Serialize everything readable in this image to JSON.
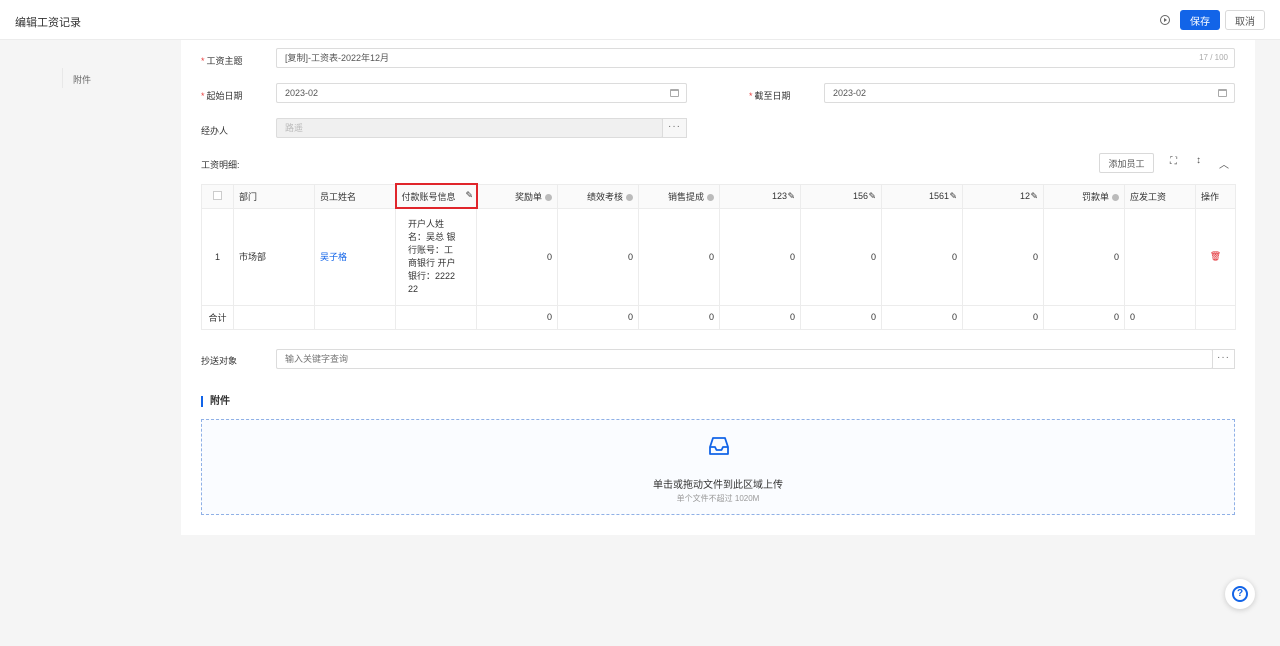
{
  "header": {
    "title": "编辑工资记录",
    "save_label": "保存",
    "cancel_label": "取消"
  },
  "sidebar": {
    "items": [
      {
        "label": "附件"
      }
    ]
  },
  "form": {
    "subject": {
      "label": "工资主题",
      "value": "[复制]-工资表-2022年12月",
      "counter": "17 / 100"
    },
    "start_date": {
      "label": "起始日期",
      "value": "2023-02"
    },
    "end_date": {
      "label": "截至日期",
      "value": "2023-02"
    },
    "handler": {
      "label": "经办人",
      "value": "路遥",
      "more": "···"
    }
  },
  "salary_detail": {
    "label": "工资明细:",
    "add_employee_label": "添加员工",
    "columns": [
      "部门",
      "员工姓名",
      "付款账号信息",
      "奖励单",
      "绩效考核",
      "销售提成",
      "123",
      "156",
      "1561",
      "12",
      "罚款单",
      "应发工资",
      "操作"
    ],
    "rows": [
      {
        "index": "1",
        "department": "市场部",
        "employee": "吴子格",
        "account_lines": [
          "开户人姓",
          "名：吴总 银",
          "行账号：工",
          "商银行 开户",
          "银行：2222",
          "22"
        ],
        "values": [
          "0",
          "0",
          "0",
          "0",
          "0",
          "0",
          "0",
          "0",
          ""
        ]
      }
    ],
    "total": {
      "label": "合计",
      "values": [
        "0",
        "0",
        "0",
        "0",
        "0",
        "0",
        "0",
        "0",
        "0"
      ]
    }
  },
  "cc": {
    "label": "抄送对象",
    "placeholder": "输入关键字查询",
    "more": "···"
  },
  "attachment": {
    "title": "附件",
    "upload_text": "单击或拖动文件到此区域上传",
    "upload_hint": "单个文件不超过 1020M"
  },
  "icons": {
    "help": "question-circle-icon",
    "upload": "inbox-icon",
    "delete": "trash-icon",
    "edit": "pencil-icon"
  },
  "colors": {
    "primary": "#1264e8",
    "danger": "#e0252b"
  }
}
